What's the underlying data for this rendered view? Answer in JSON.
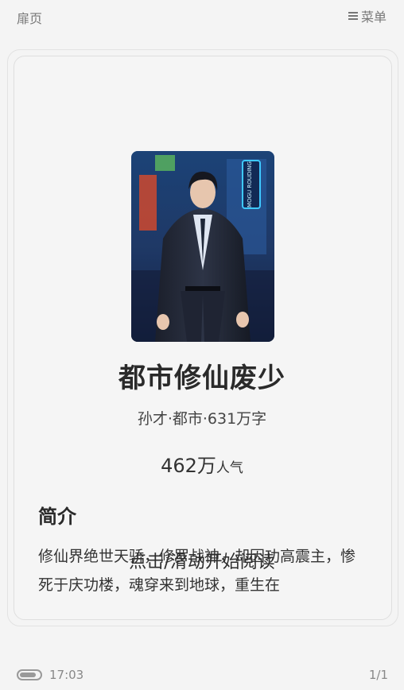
{
  "header": {
    "left_label": "扉页",
    "menu_label": "菜单"
  },
  "book": {
    "title": "都市修仙废少",
    "meta": "孙才·都市·631万字",
    "popularity_value": "462万",
    "popularity_label": "人气",
    "cover_sign_text": "MOGU ROUDING"
  },
  "intro": {
    "heading": "简介",
    "text": "修仙界绝世天骄，修罗战神，却因功高震主，惨死于庆功楼，魂穿来到地球，重生在"
  },
  "hint": {
    "text": "点击/滑动开始阅读"
  },
  "footer": {
    "time": "17:03",
    "page": "1/1",
    "battery_level": 0.85
  },
  "colors": {
    "background": "#f4f4f4",
    "text": "#222222",
    "muted": "#777777"
  }
}
